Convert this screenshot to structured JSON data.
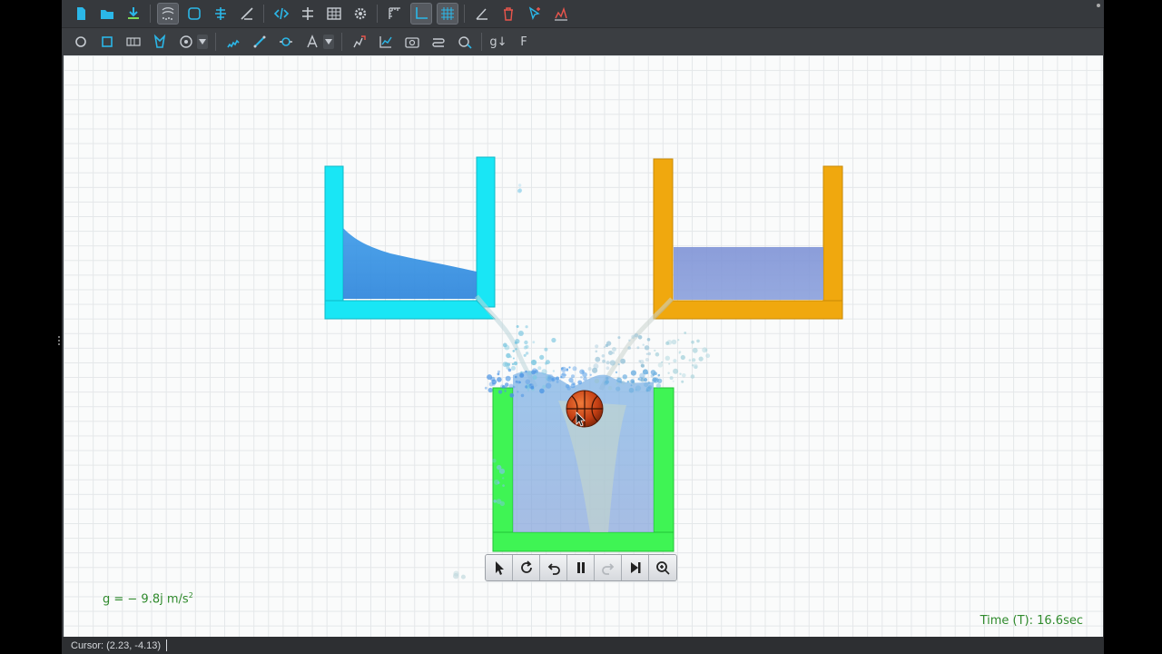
{
  "toolbar_primary": {
    "buttons": [
      {
        "name": "new-file-icon",
        "active": false
      },
      {
        "name": "open-folder-icon",
        "active": false
      },
      {
        "name": "save-download-icon",
        "active": false
      },
      {
        "sep": true
      },
      {
        "name": "particles-tool-icon",
        "active": true
      },
      {
        "name": "shape-select-icon",
        "active": false
      },
      {
        "name": "align-icon",
        "active": false
      },
      {
        "name": "measure-angle-icon",
        "active": false
      },
      {
        "sep": true
      },
      {
        "name": "code-icon",
        "active": false
      },
      {
        "name": "distribute-icon",
        "active": false
      },
      {
        "name": "table-icon",
        "active": false
      },
      {
        "name": "settings-gear-icon",
        "active": false
      },
      {
        "sep": true
      },
      {
        "name": "ruler-icon",
        "active": false
      },
      {
        "name": "axes-icon",
        "active": true
      },
      {
        "name": "grid-icon",
        "active": true
      },
      {
        "sep": true
      },
      {
        "name": "angle-icon",
        "active": false
      },
      {
        "name": "trash-icon",
        "active": false
      },
      {
        "name": "pointer-plus-icon",
        "active": false
      },
      {
        "name": "graph-plot-icon",
        "active": false
      }
    ]
  },
  "toolbar_secondary": {
    "buttons": [
      {
        "name": "circle-tool-icon"
      },
      {
        "name": "polygon-tool-icon"
      },
      {
        "name": "box-tool-icon"
      },
      {
        "name": "custom-shape-icon"
      },
      {
        "name": "target-tool-icon",
        "dropdown": true
      },
      {
        "sep": true
      },
      {
        "name": "spring-tool-icon"
      },
      {
        "name": "rod-tool-icon"
      },
      {
        "name": "hinge-tool-icon"
      },
      {
        "name": "text-tool-icon",
        "dropdown": true
      },
      {
        "sep": true
      },
      {
        "name": "force-tool-icon"
      },
      {
        "name": "chart-tool-icon"
      },
      {
        "name": "camera-tool-icon"
      },
      {
        "name": "path-tool-icon"
      },
      {
        "name": "tracer-tool-icon"
      },
      {
        "sep": true
      },
      {
        "name": "gravity-toggle-icon",
        "text": "g↓"
      },
      {
        "name": "force-field-icon",
        "text": "F"
      }
    ]
  },
  "scene": {
    "colors": {
      "left_container": "#19e6f5",
      "right_container": "#f0a80e",
      "bottom_container": "#3ff454",
      "water": "#3a8fe0",
      "ball": "#d0451a"
    }
  },
  "labels": {
    "gravity_prefix": "g = − 9.8",
    "gravity_vec": "j",
    "gravity_unit": " m/s",
    "gravity_exp": "2",
    "time": "Time (T): 16.6sec"
  },
  "controls": [
    {
      "name": "select-pointer-icon",
      "enabled": true
    },
    {
      "name": "reset-rotate-icon",
      "enabled": true
    },
    {
      "name": "undo-icon",
      "enabled": true
    },
    {
      "name": "pause-icon",
      "enabled": true
    },
    {
      "name": "redo-icon",
      "enabled": false
    },
    {
      "name": "step-forward-icon",
      "enabled": true
    },
    {
      "name": "zoom-icon",
      "enabled": true
    }
  ],
  "status": {
    "cursor": "Cursor: (2.23, -4.13)"
  }
}
